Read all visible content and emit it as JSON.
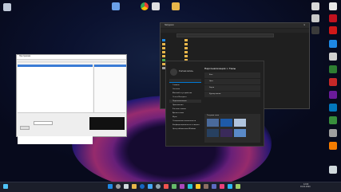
{
  "explorer": {
    "title": "Загрузки",
    "rows": [
      "Папка 1",
      "Папка 2",
      "Папка 3",
      "Папка 4",
      "Папка 5",
      "Папка 6",
      "Папка 7",
      "Папка 8"
    ]
  },
  "settings": {
    "user": "Учетная запись",
    "breadcrumb_parent": "Персонализация",
    "breadcrumb_sep": ">",
    "breadcrumb_current": "Темы",
    "nav": [
      "Главная",
      "Система",
      "Bluetooth и устройства",
      "Сеть и Интернет",
      "Персонализация",
      "Приложения",
      "Учетные записи",
      "Время и язык",
      "Игры",
      "Специальные возможности",
      "Конфиденциальность и защита",
      "Центр обновления Windows"
    ],
    "options": [
      "Фон",
      "Цвет",
      "Звуки",
      "Курсор мыши"
    ],
    "current_theme_label": "Текущая тема"
  },
  "app": {
    "title": "Программа"
  },
  "colors": {
    "accent": "#0078d4",
    "folder": "#e8b64a",
    "settings_bg": "#202020",
    "explorer_bg": "#1f1f1f"
  },
  "taskbar": {
    "time": "12:00",
    "date": "01.01.2024"
  }
}
